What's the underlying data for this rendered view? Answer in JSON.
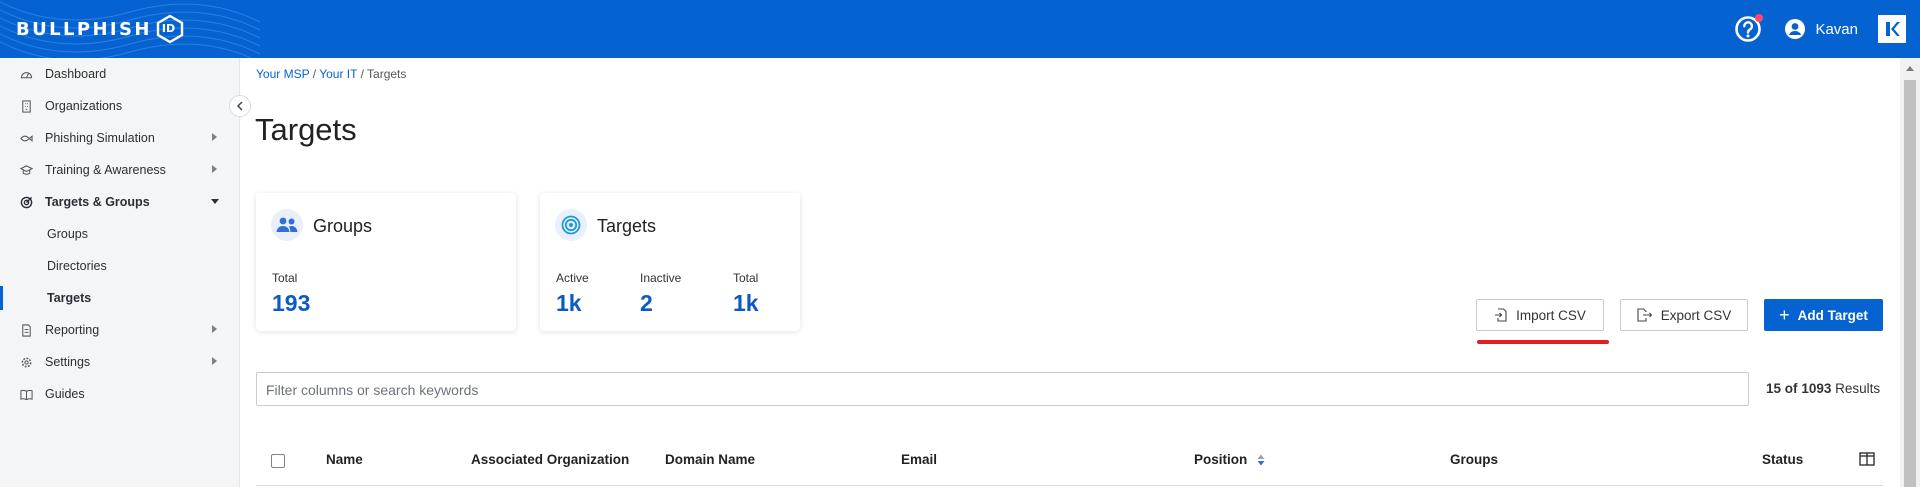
{
  "header": {
    "logo_text": "BULLPHISH",
    "logo_badge": "ID",
    "user_name": "Kavan",
    "brand_color": "#0563d1"
  },
  "sidebar": {
    "items": [
      {
        "label": "Dashboard",
        "icon": "gauge-icon"
      },
      {
        "label": "Organizations",
        "icon": "building-icon"
      },
      {
        "label": "Phishing Simulation",
        "icon": "fish-hook-icon"
      },
      {
        "label": "Training & Awareness",
        "icon": "graduation-cap-icon"
      },
      {
        "label": "Targets & Groups",
        "icon": "target-icon"
      },
      {
        "label": "Reporting",
        "icon": "report-icon"
      },
      {
        "label": "Settings",
        "icon": "gear-icon"
      },
      {
        "label": "Guides",
        "icon": "book-icon"
      }
    ],
    "sub_items": [
      {
        "label": "Groups"
      },
      {
        "label": "Directories"
      },
      {
        "label": "Targets"
      }
    ]
  },
  "breadcrumb": {
    "level1": "Your MSP",
    "level2": "Your IT",
    "current": "Targets",
    "separator": "/"
  },
  "page": {
    "title": "Targets"
  },
  "cards": {
    "groups": {
      "title": "Groups",
      "total_label": "Total",
      "total_value": "193"
    },
    "targets": {
      "title": "Targets",
      "active_label": "Active",
      "active_value": "1k",
      "inactive_label": "Inactive",
      "inactive_value": "2",
      "total_label": "Total",
      "total_value": "1k"
    }
  },
  "actions": {
    "import_label": "Import CSV",
    "export_label": "Export CSV",
    "add_label": "Add Target"
  },
  "search": {
    "placeholder": "Filter columns or search keywords"
  },
  "results": {
    "shown": "15",
    "of_word": "of",
    "total": "1093",
    "suffix": "Results"
  },
  "table": {
    "columns": [
      "Name",
      "Associated Organization",
      "Domain Name",
      "Email",
      "Position",
      "Groups",
      "Status"
    ]
  },
  "annotation_color": "#e41c23"
}
